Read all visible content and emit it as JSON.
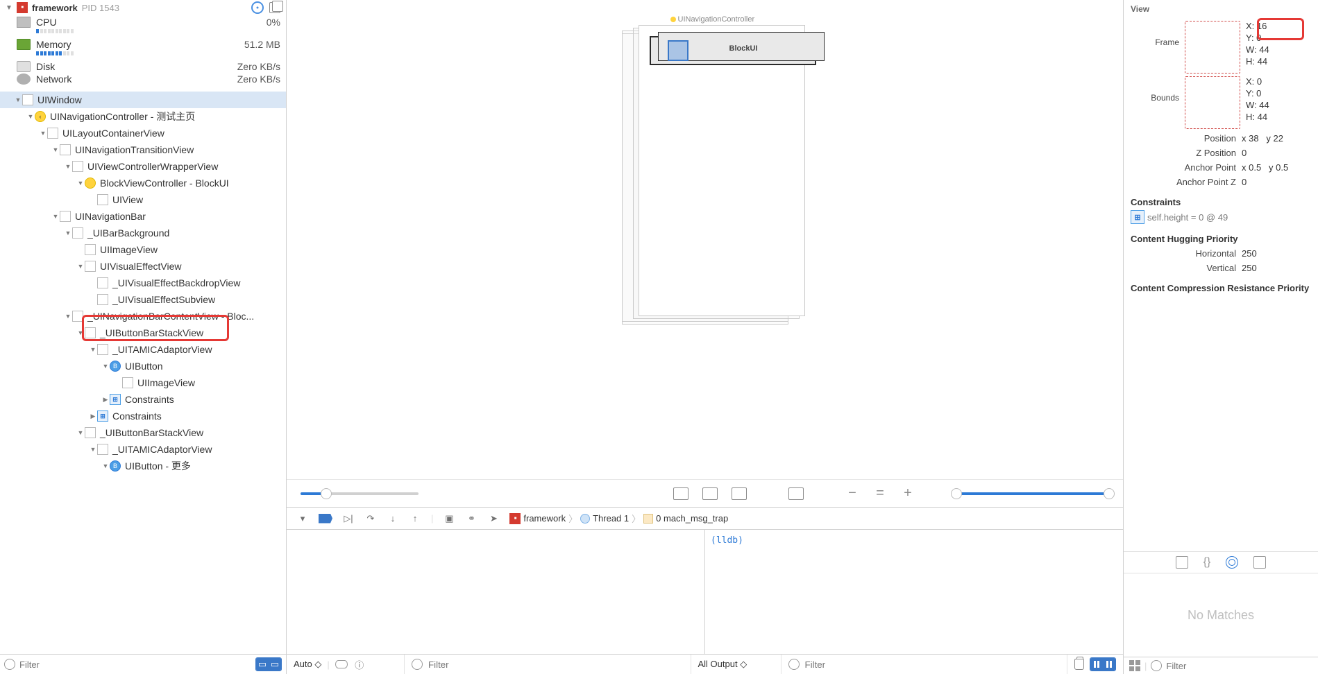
{
  "process": {
    "name": "framework",
    "pid_label": "PID 1543"
  },
  "metrics": {
    "cpu": {
      "label": "CPU",
      "value": "0%"
    },
    "memory": {
      "label": "Memory",
      "value": "51.2 MB"
    },
    "disk": {
      "label": "Disk",
      "value": "Zero KB/s"
    },
    "network": {
      "label": "Network",
      "value": "Zero KB/s"
    }
  },
  "hierarchy": {
    "n0": "UIWindow",
    "n1": "UINavigationController - 测试主页",
    "n2": "UILayoutContainerView",
    "n3": "UINavigationTransitionView",
    "n4": "UIViewControllerWrapperView",
    "n5": "BlockViewController - BlockUI",
    "n6": "UIView",
    "n7": "UINavigationBar",
    "n8": "_UIBarBackground",
    "n9": "UIImageView",
    "n10": "UIVisualEffectView",
    "n11": "_UIVisualEffectBackdropView",
    "n12": "_UIVisualEffectSubview",
    "n13": "_UINavigationBarContentView - Bloc...",
    "n14": "_UIButtonBarStackView",
    "n15": "_UITAMICAdaptorView",
    "n16": "UIButton",
    "n17": "UIImageView",
    "n18": "Constraints",
    "n19": "Constraints",
    "n20": "_UIButtonBarStackView",
    "n21": "_UITAMICAdaptorView",
    "n22": "UIButton - 更多"
  },
  "left_filter_placeholder": "Filter",
  "canvas": {
    "vc_label": "UINavigationController",
    "navbar_title": "BlockUI"
  },
  "debug_bar": {
    "app": "framework",
    "thread": "Thread 1",
    "frame": "0 mach_msg_trap"
  },
  "console": {
    "auto_label": "Auto",
    "left_filter": "Filter",
    "output_mode": "All Output",
    "right_filter": "Filter",
    "lldb_prompt": "(lldb)"
  },
  "inspector": {
    "title": "View",
    "frame_label": "Frame",
    "frame": {
      "x": "X:  16",
      "y": "Y:  0",
      "w": "W:  44",
      "h": "H:  44"
    },
    "bounds_label": "Bounds",
    "bounds": {
      "x": "X:  0",
      "y": "Y:  0",
      "w": "W:  44",
      "h": "H:  44"
    },
    "position_label": "Position",
    "position": {
      "x": "x  38",
      "y": "y  22"
    },
    "zposition_label": "Z Position",
    "zposition": "0",
    "anchor_label": "Anchor Point",
    "anchor": {
      "x": "x  0.5",
      "y": "y  0.5"
    },
    "anchorz_label": "Anchor Point Z",
    "anchorz": "0",
    "constraints_label": "Constraints",
    "constraint0": "self.height = 0 @ 49",
    "hug_label": "Content Hugging Priority",
    "hug_h_label": "Horizontal",
    "hug_h": "250",
    "hug_v_label": "Vertical",
    "hug_v": "250",
    "comp_label": "Content Compression Resistance Priority",
    "nomatch": "No Matches",
    "filter_placeholder": "Filter"
  }
}
